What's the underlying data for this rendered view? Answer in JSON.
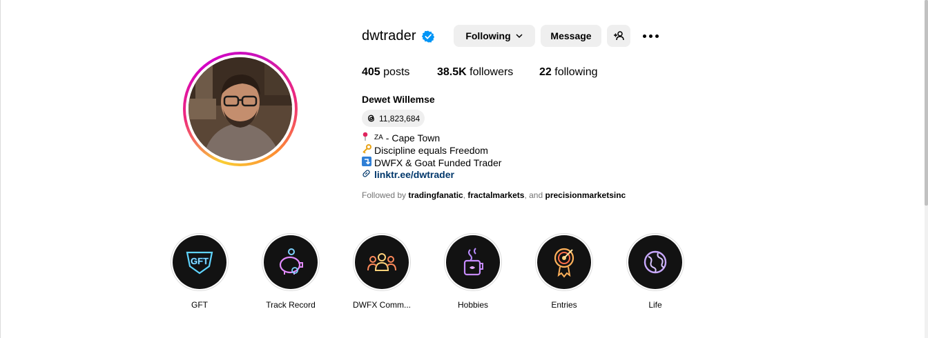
{
  "profile": {
    "username": "dwtrader",
    "verified": true,
    "full_name": "Dewet Willemse",
    "threads_count": "11,823,684",
    "buttons": {
      "following": "Following",
      "message": "Message"
    },
    "stats": {
      "posts_count": "405",
      "posts_label": "posts",
      "followers_count": "38.5K",
      "followers_label": "followers",
      "following_count": "22",
      "following_label": "following"
    },
    "bio": {
      "line1_prefix": "ZA",
      "line1_text": "- Cape Town",
      "line2_text": "Discipline equals Freedom",
      "line3_text": "DWFX & Goat Funded Trader",
      "link_text": "linktr.ee/dwtrader"
    },
    "followed_by": {
      "prefix": "Followed by",
      "user1": "tradingfanatic",
      "user2": "fractalmarkets",
      "and": "and",
      "user3": "precisionmarketsinc"
    }
  },
  "highlights": [
    {
      "label": "GFT",
      "icon": "gft-logo-icon"
    },
    {
      "label": "Track Record",
      "icon": "piggy-bank-icon"
    },
    {
      "label": "DWFX Comm...",
      "icon": "community-icon"
    },
    {
      "label": "Hobbies",
      "icon": "coffee-mug-icon"
    },
    {
      "label": "Entries",
      "icon": "target-icon"
    },
    {
      "label": "Life",
      "icon": "globe-icon"
    }
  ],
  "colors": {
    "verified_blue": "#0095f6",
    "button_bg": "#efefef",
    "link": "#00376b",
    "muted": "#737373"
  }
}
